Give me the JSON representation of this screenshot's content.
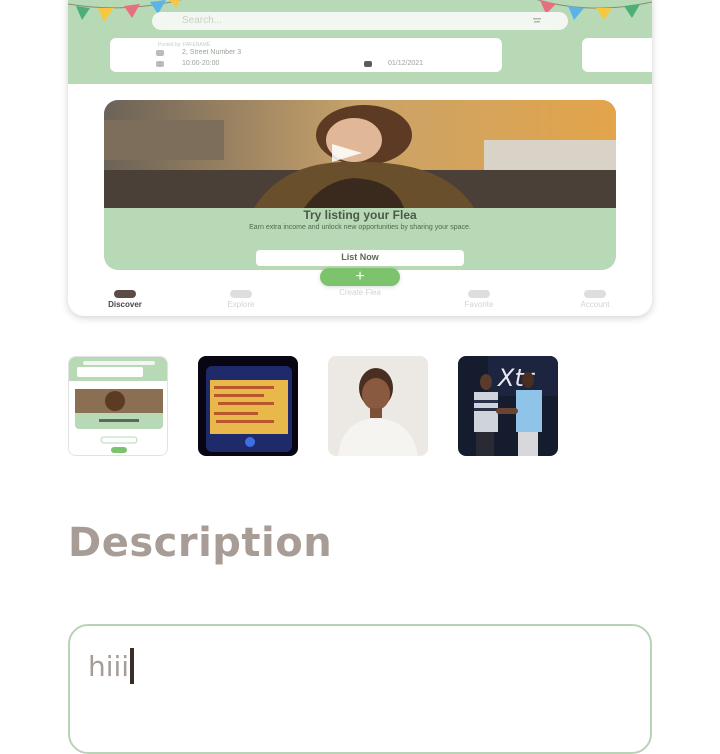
{
  "preview": {
    "search_placeholder": "Search...",
    "posted_by": "Posted by: FAKENAME",
    "address": "2, Street Number 3",
    "time": "10:00-20:00",
    "date": "01/12/2021",
    "promo_title": "Try listing your Flea",
    "promo_text": "Earn extra income and unlock new opportunities by sharing your space.",
    "list_button": "List Now",
    "create_flea": "+",
    "tabs": [
      "Discover",
      "Explore",
      "Create Flea",
      "Favorite",
      "Account"
    ],
    "active_tab": "Discover",
    "colors": {
      "header_green": "#b8d9b6",
      "fab_green": "#7dc36d"
    }
  },
  "thumbnails": [
    {
      "name": "app-screenshot-thumb",
      "icon": "app-screenshot"
    },
    {
      "name": "phone-photo-thumb",
      "icon": "phone-screen-photo"
    },
    {
      "name": "person-selfie-thumb",
      "icon": "person-photo"
    },
    {
      "name": "award-photo-thumb",
      "icon": "group-photo"
    }
  ],
  "description": {
    "heading": "Description",
    "value": "hiii"
  }
}
